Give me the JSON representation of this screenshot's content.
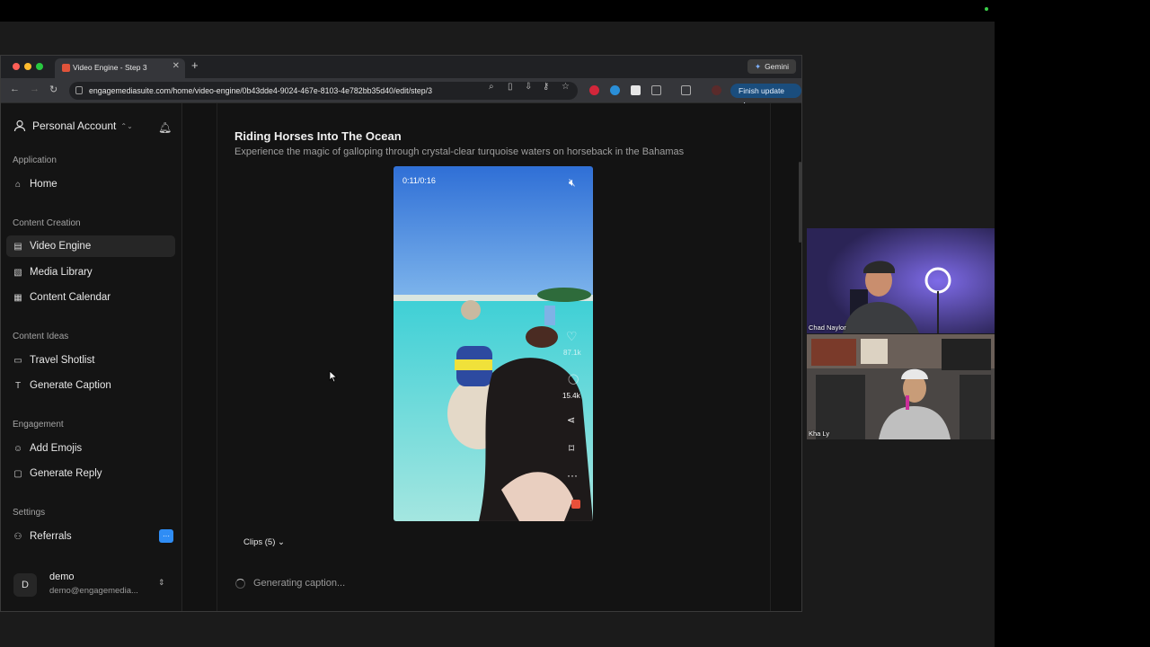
{
  "browser": {
    "tab_title": "Video Engine - Step 3",
    "url": "engagemediasuite.com/home/video-engine/0b43dde4-9024-467e-8103-4e782bb35d40/edit/step/3",
    "gemini_label": "Gemini",
    "finish_update_label": "Finish update"
  },
  "sidebar": {
    "account_label": "Personal Account",
    "sections": {
      "application": "Application",
      "content_creation": "Content Creation",
      "content_ideas": "Content Ideas",
      "engagement": "Engagement",
      "settings": "Settings"
    },
    "items": {
      "home": "Home",
      "video_engine": "Video Engine",
      "media_library": "Media Library",
      "content_calendar": "Content Calendar",
      "travel_shotlist": "Travel Shotlist",
      "generate_caption": "Generate Caption",
      "add_emojis": "Add Emojis",
      "generate_reply": "Generate Reply",
      "referrals": "Referrals"
    },
    "referrals_badge": "···",
    "user": {
      "initial": "D",
      "name": "demo",
      "email": "demo@engagemedia..."
    }
  },
  "main": {
    "title": "Riding Horses Into The Ocean",
    "subtitle": "Experience the magic of galloping through crystal-clear turquoise waters on horseback in the Bahamas",
    "video": {
      "time": "0:11/0:16",
      "likes": "87.1k",
      "comments": "15.4k"
    },
    "clips_label": "Clips (5)",
    "generating_label": "Generating caption..."
  },
  "participants": [
    {
      "name": "Chad Naylor"
    },
    {
      "name": "Kha Ly"
    }
  ]
}
